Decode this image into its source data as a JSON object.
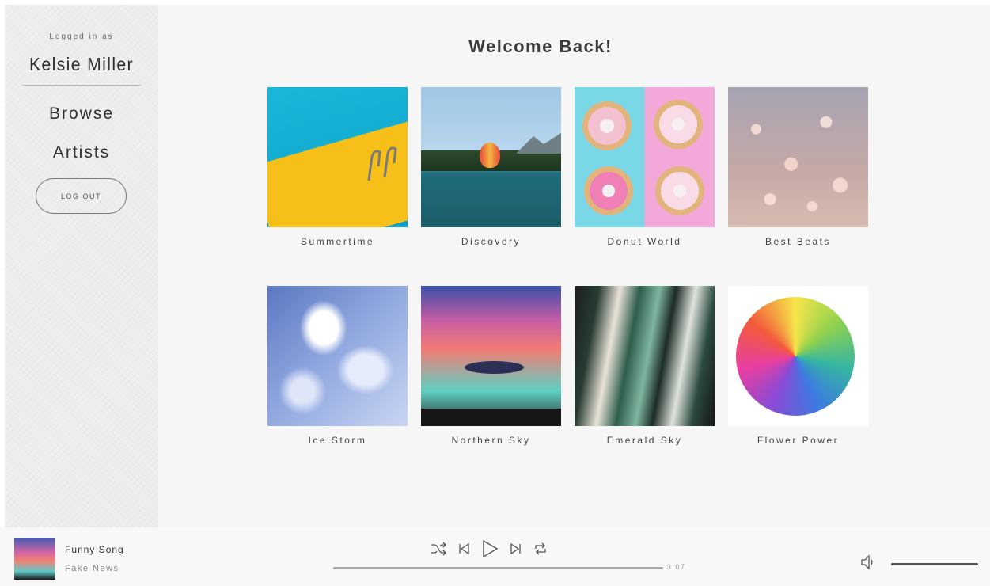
{
  "sidebar": {
    "logged_in_label": "Logged in as",
    "user_name": "Kelsie Miller",
    "nav": [
      {
        "label": "Browse"
      },
      {
        "label": "Artists"
      }
    ],
    "logout_label": "LOG OUT"
  },
  "main": {
    "welcome": "Welcome Back!",
    "playlists": [
      {
        "title": "Summertime"
      },
      {
        "title": "Discovery"
      },
      {
        "title": "Donut World"
      },
      {
        "title": "Best Beats"
      },
      {
        "title": "Ice Storm"
      },
      {
        "title": "Northern Sky"
      },
      {
        "title": "Emerald Sky"
      },
      {
        "title": "Flower Power"
      }
    ]
  },
  "player": {
    "song_title": "Funny Song",
    "song_artist": "Fake News",
    "duration": "3:07",
    "progress_fraction": 1.0,
    "volume_fraction": 1.0,
    "controls": [
      "shuffle-icon",
      "previous-icon",
      "play-icon",
      "next-icon",
      "repeat-icon"
    ]
  },
  "colors": {
    "sidebar_bg": "#efefee",
    "main_bg": "#f6f6f6",
    "text": "#3a3a3a"
  }
}
